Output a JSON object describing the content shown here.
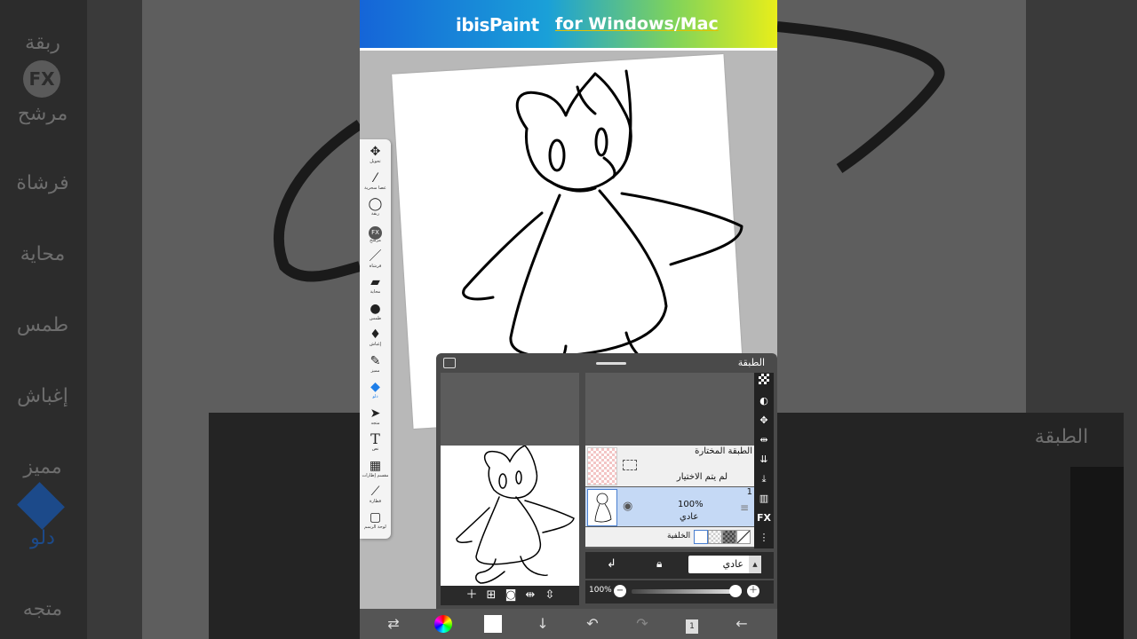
{
  "banner": {
    "logo": "ibisPaint",
    "platform": "for Windows/Mac"
  },
  "toolbar": {
    "tools": [
      {
        "label": "تحويل",
        "icon": "move-icon"
      },
      {
        "label": "عصا سحرية",
        "icon": "magic-wand-icon"
      },
      {
        "label": "ربقة",
        "icon": "lasso-icon"
      },
      {
        "label": "مرشح",
        "icon": "fx-filter-icon"
      },
      {
        "label": "فرشاة",
        "icon": "brush-icon"
      },
      {
        "label": "محاية",
        "icon": "eraser-icon"
      },
      {
        "label": "طمس",
        "icon": "smudge-icon"
      },
      {
        "label": "إغباش",
        "icon": "blur-icon"
      },
      {
        "label": "مميز",
        "icon": "special-icon"
      },
      {
        "label": "دلو",
        "icon": "bucket-icon"
      },
      {
        "label": "متجه",
        "icon": "select-arrow-icon"
      },
      {
        "label": "نص",
        "icon": "text-icon"
      },
      {
        "label": "مقسم إطارات",
        "icon": "frame-divider-icon"
      },
      {
        "label": "قطارة",
        "icon": "eyedropper-icon"
      },
      {
        "label": "لوحة الرسم",
        "icon": "canvas-icon"
      }
    ],
    "active_index": 9
  },
  "layer_panel": {
    "title": "الطبقة",
    "selection_layer": {
      "title": "الطبقة المختارة",
      "status": "لم يتم الاختيار"
    },
    "layer": {
      "number": "1",
      "opacity": "100%",
      "blend": "عادي"
    },
    "background": {
      "label": "الخلفية"
    },
    "blend_mode": "عادي",
    "opacity_label": "100%",
    "opacity_value": 1.0,
    "fx_label": "FX"
  },
  "background_ghost": {
    "left_labels": [
      "ربقة",
      "مرشح",
      "فرشاة",
      "محاية",
      "طمس",
      "إغباش",
      "مميز",
      "دلو",
      "متجه"
    ],
    "fx": "FX",
    "right_title": "الطبقة"
  },
  "colors": {
    "active_tool": "#1e7ee8",
    "panel": "#4a4a4a",
    "banner_start": "#1565d8",
    "banner_end": "#e8ee1a"
  }
}
